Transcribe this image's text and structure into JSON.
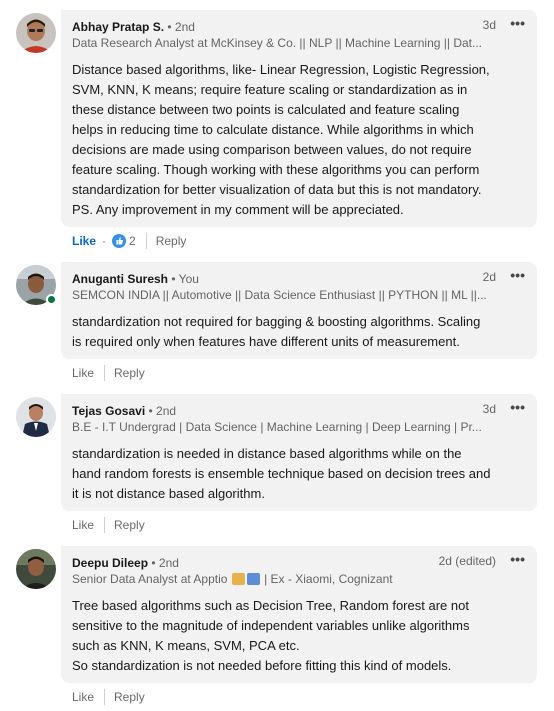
{
  "comments": [
    {
      "name": "Abhay Pratap S.",
      "degree": " • 2nd",
      "time": "3d",
      "headline": "Data Research Analyst at McKinsey & Co. || NLP || Machine Learning || Dat...",
      "text": "Distance based algorithms, like- Linear Regression, Logistic Regression,\nSVM, KNN, K means; require feature scaling or standardization as in\nthese distance between two points is calculated and feature scaling\nhelps in reducing time to calculate distance. While algorithms in which\ndecisions are made using comparison between values, do not require\nfeature scaling. Though working with these algorithms you can perform\nstandardization for better visualization of data but this is not mandatory.\nPS. Any improvement in my comment will be appreciated.",
      "like_label": "Like",
      "reaction_count": "2",
      "reply_label": "Reply"
    },
    {
      "name": "Anuganti Suresh",
      "degree": " • You",
      "time": "2d",
      "headline": "SEMCON INDIA || Automotive || Data Science Enthusiast || PYTHON || ML ||...",
      "text": "standardization not required for bagging & boosting algorithms. Scaling\nis required only when features have different units of measurement.",
      "like_label": "Like",
      "reply_label": "Reply"
    },
    {
      "name": "Tejas Gosavi",
      "degree": " • 2nd",
      "time": "3d",
      "headline": "B.E - I.T Undergrad | Data Science | Machine Learning | Deep Learning | Pr...",
      "text": "standardization is needed in distance based algorithms while on the\nhand random forests is ensemble technique based on decision trees and\nit is not distance based algorithm.",
      "like_label": "Like",
      "reply_label": "Reply"
    },
    {
      "name": "Deepu Dileep",
      "degree": " • 2nd",
      "time": "2d (edited)",
      "headline_prefix": "Senior Data Analyst at Apptio ",
      "headline_suffix": " | Ex - Xiaomi, Cognizant",
      "text": "Tree based algorithms such as Decision Tree, Random forest are not\nsensitive to the magnitude of independent variables unlike algorithms\nsuch as KNN, K means, SVM, PCA etc.\nSo standardization is not needed before fitting this kind of models.",
      "like_label": "Like",
      "reply_label": "Reply"
    }
  ],
  "more_icon": "•••",
  "colors": {
    "bubble": "#f2f2f2",
    "link_blue": "#0a66c2",
    "online_green": "#057642"
  }
}
